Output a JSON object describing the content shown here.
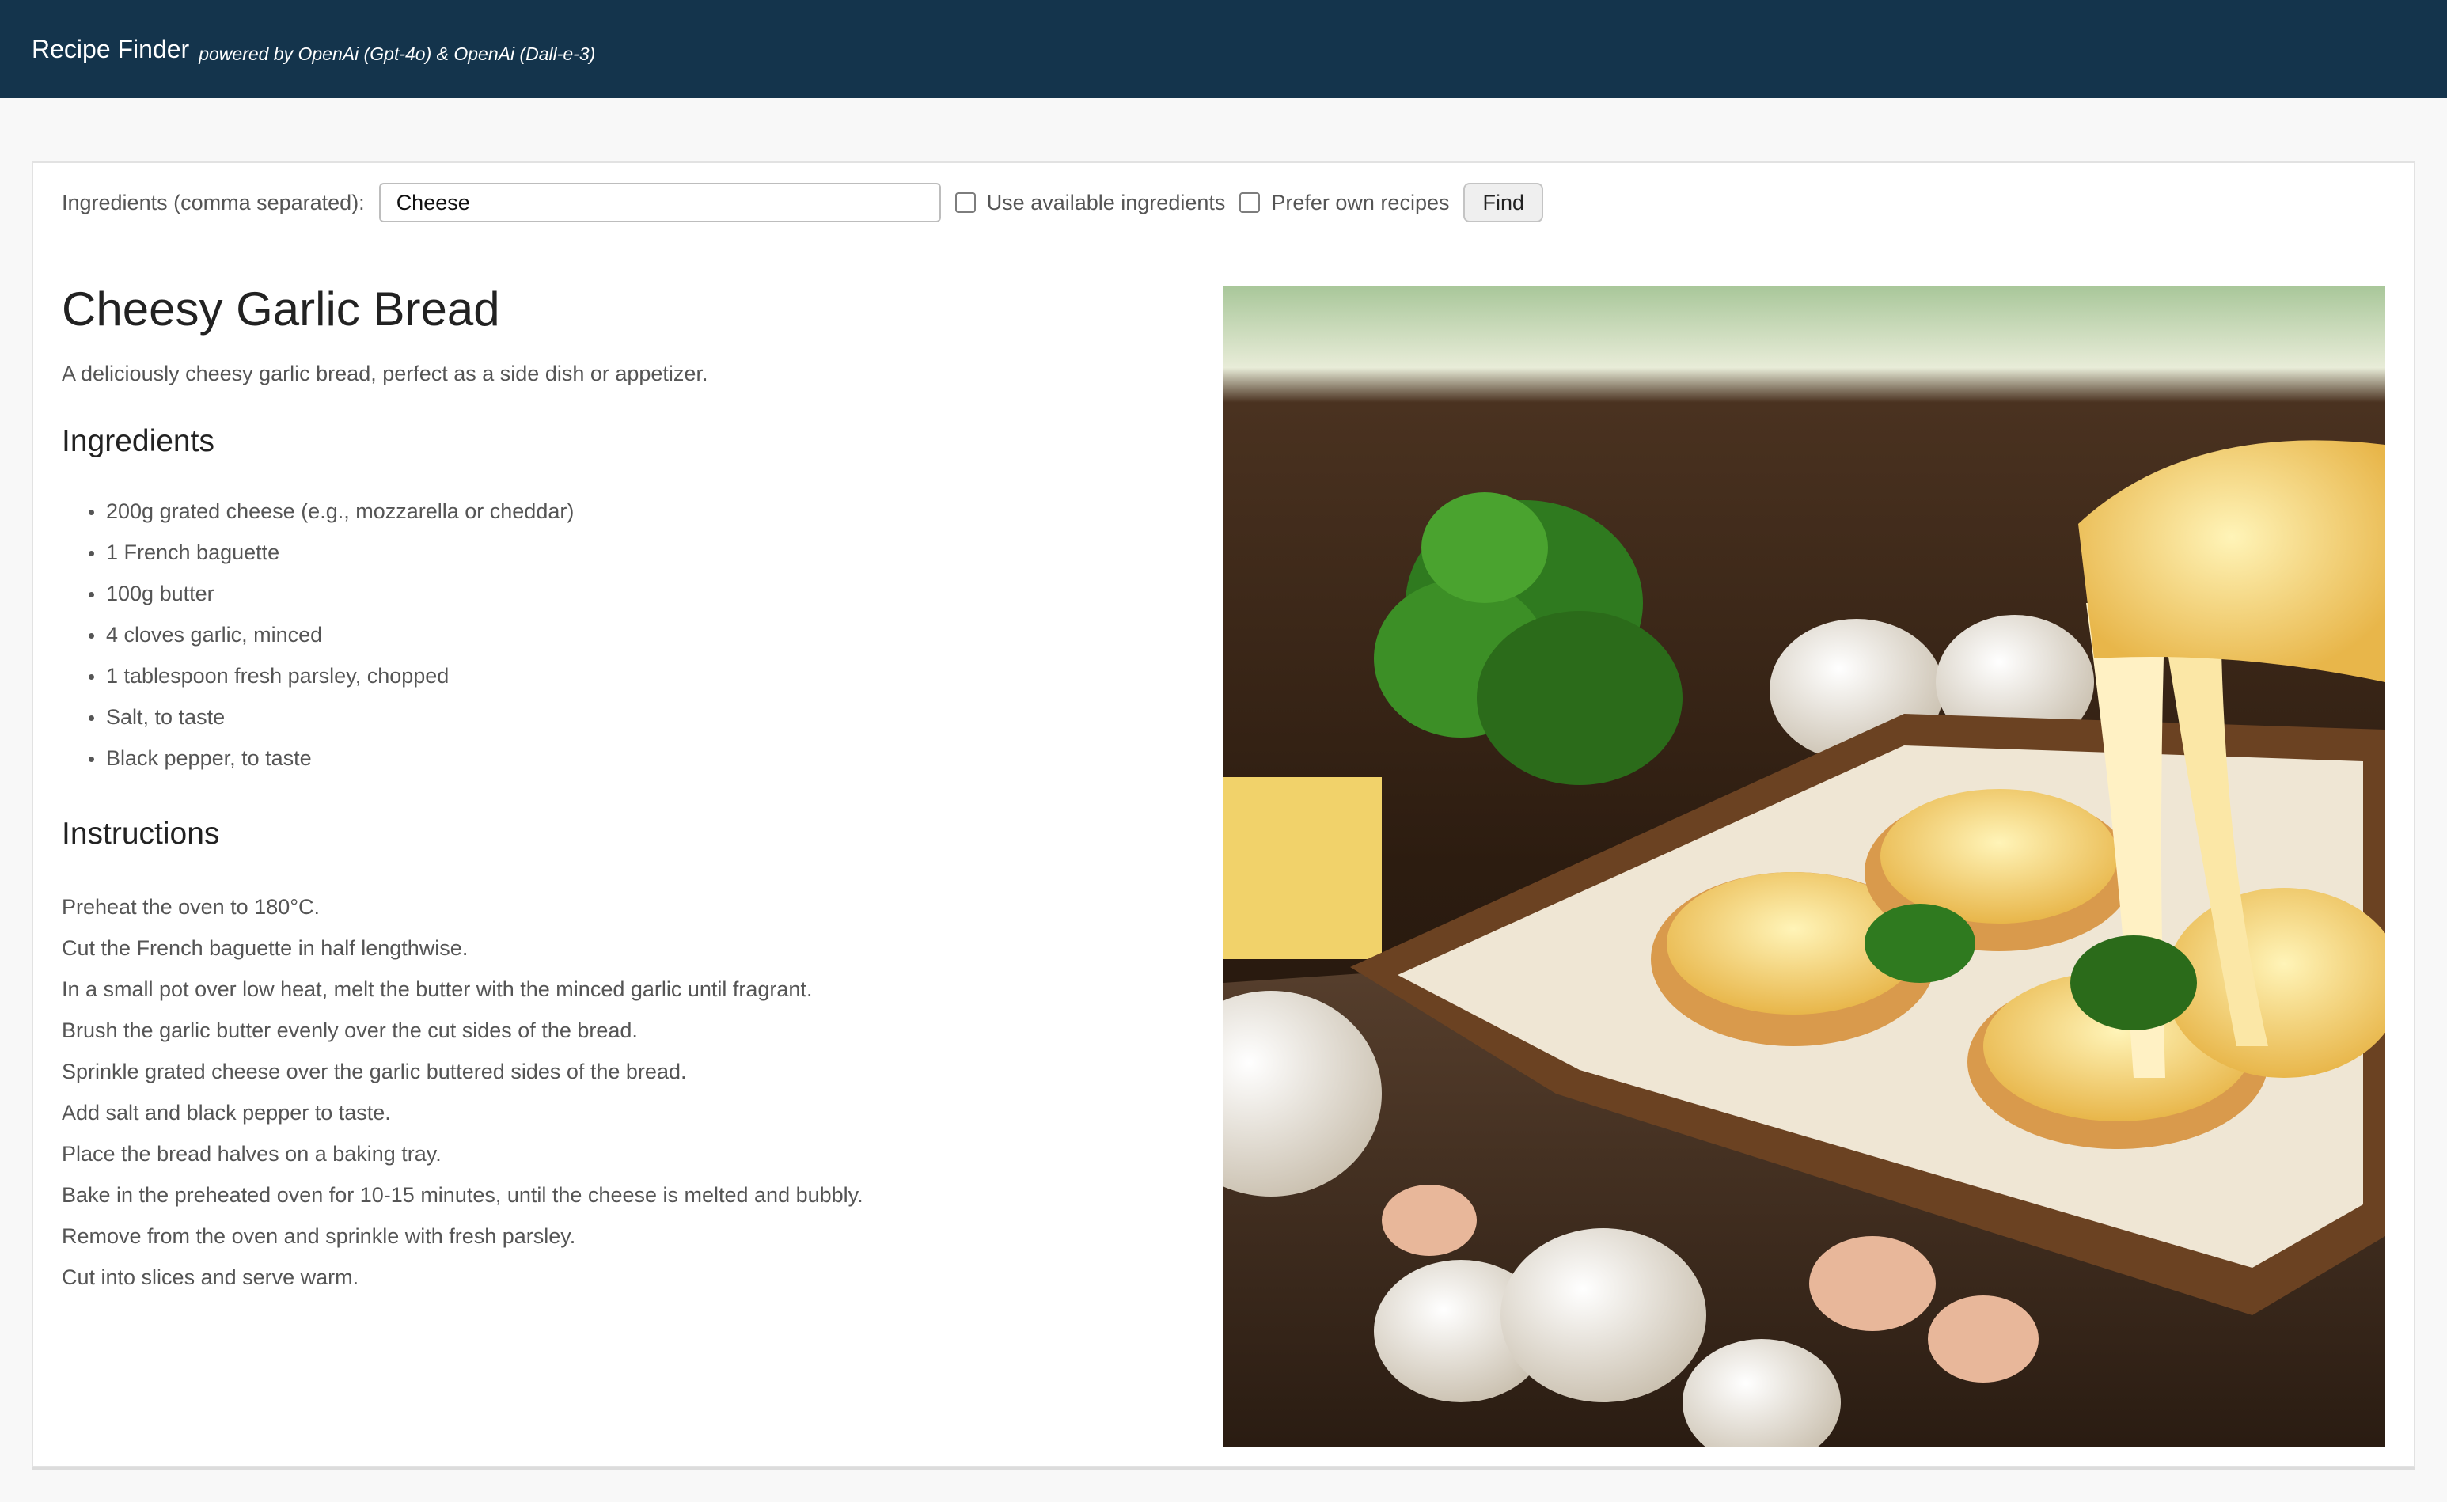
{
  "header": {
    "title": "Recipe Finder",
    "powered_by": "powered by OpenAi (Gpt-4o) & OpenAi (Dall-e-3)"
  },
  "search": {
    "label": "Ingredients (comma separated):",
    "value": "Cheese",
    "use_available_label": "Use available ingredients",
    "use_available_checked": false,
    "prefer_own_label": "Prefer own recipes",
    "prefer_own_checked": false,
    "find_label": "Find"
  },
  "recipe": {
    "title": "Cheesy Garlic Bread",
    "description": "A deliciously cheesy garlic bread, perfect as a side dish or appetizer.",
    "ingredients_heading": "Ingredients",
    "ingredients": [
      "200g grated cheese (e.g., mozzarella or cheddar)",
      "1 French baguette",
      "100g butter",
      "4 cloves garlic, minced",
      "1 tablespoon fresh parsley, chopped",
      "Salt, to taste",
      "Black pepper, to taste"
    ],
    "instructions_heading": "Instructions",
    "instructions": [
      "Preheat the oven to 180°C.",
      "Cut the French baguette in half lengthwise.",
      "In a small pot over low heat, melt the butter with the minced garlic until fragrant.",
      "Brush the garlic butter evenly over the cut sides of the bread.",
      "Sprinkle grated cheese over the garlic buttered sides of the bread.",
      "Add salt and black pepper to taste.",
      "Place the bread halves on a baking tray.",
      "Bake in the preheated oven for 10-15 minutes, until the cheese is melted and bubbly.",
      "Remove from the oven and sprinkle with fresh parsley.",
      "Cut into slices and serve warm."
    ]
  },
  "colors": {
    "header_bg": "#14344c",
    "page_bg": "#f8f8f8"
  }
}
